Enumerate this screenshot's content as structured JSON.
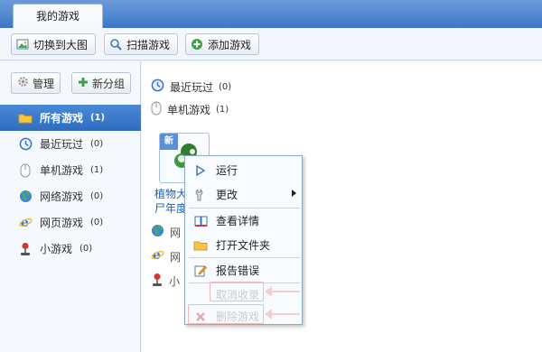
{
  "window": {
    "tab_label": "我的游戏"
  },
  "toolbar": {
    "switch_view_label": "切换到大图",
    "scan_label": "扫描游戏",
    "add_label": "添加游戏"
  },
  "sidebar": {
    "manage_label": "管理",
    "new_group_label": "新分组",
    "items": [
      {
        "label": "所有游戏",
        "count": "(1)",
        "icon": "folder-icon"
      },
      {
        "label": "最近玩过",
        "count": "(0)",
        "icon": "clock-icon"
      },
      {
        "label": "单机游戏",
        "count": "(1)",
        "icon": "mouse-icon"
      },
      {
        "label": "网络游戏",
        "count": "(0)",
        "icon": "globe-icon"
      },
      {
        "label": "网页游戏",
        "count": "(0)",
        "icon": "ie-icon"
      },
      {
        "label": "小游戏",
        "count": "(0)",
        "icon": "joystick-icon"
      }
    ]
  },
  "main": {
    "recent_label": "最近玩过",
    "recent_count": "(0)",
    "single_label": "单机游戏",
    "single_count": "(1)",
    "tile_badge": "新",
    "tile_title_line1": "植物大",
    "tile_title_line2": "尸年度",
    "frag_network": "网",
    "frag_web": "网",
    "frag_mini": "小"
  },
  "context_menu": {
    "items": [
      {
        "label": "运行",
        "icon": "play-icon"
      },
      {
        "label": "更改",
        "icon": "wrench-icon",
        "submenu": true
      },
      {
        "label": "查看详情",
        "icon": "book-icon"
      },
      {
        "label": "打开文件夹",
        "icon": "folder-icon"
      },
      {
        "label": "报告错误",
        "icon": "edit-icon"
      },
      {
        "label": "取消收录",
        "icon": "",
        "disabled": true
      },
      {
        "label": "删除游戏",
        "icon": "delete-icon",
        "disabled": true
      }
    ]
  },
  "colors": {
    "accent": "#3e76c6",
    "active_bg": "#2f6cc0",
    "link": "#1f5fb3",
    "highlight": "#f2b9b9"
  }
}
